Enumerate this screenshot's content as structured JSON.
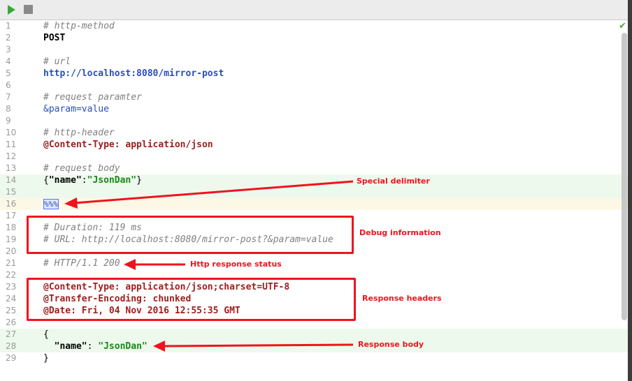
{
  "toolbar": {
    "run_icon": "play-icon",
    "stop_icon": "stop-icon"
  },
  "status": {
    "check": "✔"
  },
  "lines": [
    {
      "n": "1",
      "t": "# http-method",
      "c": "comment"
    },
    {
      "n": "2",
      "t": "POST",
      "c": "kw"
    },
    {
      "n": "3",
      "t": "",
      "c": ""
    },
    {
      "n": "4",
      "t": "# url",
      "c": "comment"
    },
    {
      "n": "5",
      "t": "http://localhost:8080/mirror-post",
      "c": "url"
    },
    {
      "n": "6",
      "t": "",
      "c": ""
    },
    {
      "n": "7",
      "t": "# request paramter",
      "c": "comment"
    },
    {
      "n": "8",
      "t": "&param=value",
      "c": "param"
    },
    {
      "n": "9",
      "t": "",
      "c": ""
    },
    {
      "n": "10",
      "t": "# http-header",
      "c": "comment"
    },
    {
      "n": "11",
      "t": "@Content-Type: application/json",
      "c": "hdr"
    },
    {
      "n": "12",
      "t": "",
      "c": ""
    },
    {
      "n": "13",
      "t": "# request body",
      "c": "comment"
    },
    {
      "n": "14",
      "t": "",
      "c": "json1"
    },
    {
      "n": "15",
      "t": "",
      "c": ""
    },
    {
      "n": "16",
      "t": "%%%",
      "c": "delim"
    },
    {
      "n": "17",
      "t": "",
      "c": ""
    },
    {
      "n": "18",
      "t": "# Duration: 119 ms",
      "c": "comment"
    },
    {
      "n": "19",
      "t": "# URL: http://localhost:8080/mirror-post?&param=value",
      "c": "comment"
    },
    {
      "n": "20",
      "t": "",
      "c": ""
    },
    {
      "n": "21",
      "t": "# HTTP/1.1 200",
      "c": "comment"
    },
    {
      "n": "22",
      "t": "",
      "c": ""
    },
    {
      "n": "23",
      "t": "@Content-Type: application/json;charset=UTF-8",
      "c": "hdr"
    },
    {
      "n": "24",
      "t": "@Transfer-Encoding: chunked",
      "c": "hdr"
    },
    {
      "n": "25",
      "t": "@Date: Fri, 04 Nov 2016 12:55:35 GMT",
      "c": "hdr"
    },
    {
      "n": "26",
      "t": "",
      "c": ""
    },
    {
      "n": "27",
      "t": "{",
      "c": "punct"
    },
    {
      "n": "28",
      "t": "",
      "c": "json2"
    },
    {
      "n": "29",
      "t": "}",
      "c": "punct"
    }
  ],
  "json_request": {
    "open": "{",
    "key": "\"name\"",
    "colon": ":",
    "value": "\"JsonDan\"",
    "close": "}"
  },
  "json_response": {
    "indent": "  ",
    "key": "\"name\"",
    "colon": ": ",
    "value": "\"JsonDan\""
  },
  "annotations": {
    "special_delimiter": "Special delimiter",
    "debug_information": "Debug information",
    "http_response_status": "Http response status",
    "response_headers": "Response headers",
    "response_body": "Response body"
  },
  "colors": {
    "annotation": "#f0131e",
    "run": "#3aa83a"
  }
}
